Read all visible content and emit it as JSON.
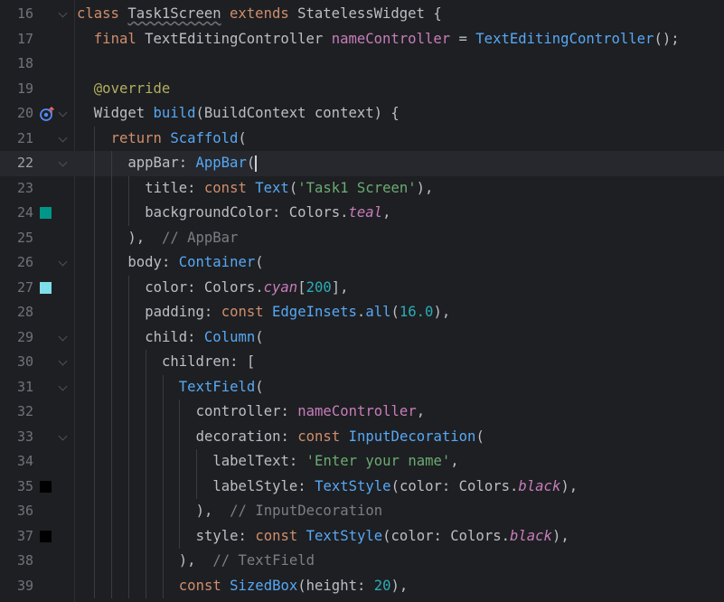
{
  "editor": {
    "current_line": "22",
    "lines": [
      {
        "n": "16",
        "ind": 0,
        "fold": true,
        "tokens": [
          {
            "t": "class ",
            "c": "kw"
          },
          {
            "t": "Task1Screen",
            "c": "cls wavy"
          },
          {
            "t": " extends ",
            "c": "kw"
          },
          {
            "t": "StatelessWidget {",
            "c": "cls"
          }
        ]
      },
      {
        "n": "17",
        "ind": 1,
        "tokens": [
          {
            "t": "final ",
            "c": "kw"
          },
          {
            "t": "TextEditingController ",
            "c": "cls"
          },
          {
            "t": "nameController",
            "c": "fld"
          },
          {
            "t": " = ",
            "c": "cls"
          },
          {
            "t": "TextEditingController",
            "c": "typ"
          },
          {
            "t": "();",
            "c": "cls"
          }
        ]
      },
      {
        "n": "18",
        "ind": 0,
        "tokens": []
      },
      {
        "n": "19",
        "ind": 1,
        "tokens": [
          {
            "t": "@override",
            "c": "ann"
          }
        ]
      },
      {
        "n": "20",
        "ind": 1,
        "fold": true,
        "icon": "override-icon",
        "tokens": [
          {
            "t": "Widget ",
            "c": "cls"
          },
          {
            "t": "build",
            "c": "typ"
          },
          {
            "t": "(BuildContext context) {",
            "c": "cls"
          }
        ]
      },
      {
        "n": "21",
        "ind": 2,
        "fold": true,
        "tokens": [
          {
            "t": "return ",
            "c": "kw"
          },
          {
            "t": "Scaffold",
            "c": "typ"
          },
          {
            "t": "(",
            "c": "cls"
          }
        ]
      },
      {
        "n": "22",
        "ind": 3,
        "fold": true,
        "caret": true,
        "tokens": [
          {
            "t": "appBar: ",
            "c": "cls"
          },
          {
            "t": "AppBar",
            "c": "typ"
          },
          {
            "t": "(",
            "c": "cls"
          }
        ]
      },
      {
        "n": "23",
        "ind": 4,
        "tokens": [
          {
            "t": "title: ",
            "c": "cls"
          },
          {
            "t": "const ",
            "c": "kw"
          },
          {
            "t": "Text",
            "c": "typ"
          },
          {
            "t": "(",
            "c": "cls"
          },
          {
            "t": "'Task1 Screen'",
            "c": "str"
          },
          {
            "t": "),",
            "c": "cls"
          }
        ]
      },
      {
        "n": "24",
        "ind": 4,
        "swatch": "#009688",
        "tokens": [
          {
            "t": "backgroundColor: Colors.",
            "c": "cls"
          },
          {
            "t": "teal",
            "c": "it"
          },
          {
            "t": ",",
            "c": "cls"
          }
        ]
      },
      {
        "n": "25",
        "ind": 3,
        "tokens": [
          {
            "t": "),  ",
            "c": "cls"
          },
          {
            "t": "// AppBar",
            "c": "cmt"
          }
        ]
      },
      {
        "n": "26",
        "ind": 3,
        "fold": true,
        "tokens": [
          {
            "t": "body: ",
            "c": "cls"
          },
          {
            "t": "Container",
            "c": "typ"
          },
          {
            "t": "(",
            "c": "cls"
          }
        ]
      },
      {
        "n": "27",
        "ind": 4,
        "swatch": "#80deea",
        "tokens": [
          {
            "t": "color: Colors.",
            "c": "cls"
          },
          {
            "t": "cyan",
            "c": "it"
          },
          {
            "t": "[",
            "c": "cls"
          },
          {
            "t": "200",
            "c": "num"
          },
          {
            "t": "],",
            "c": "cls"
          }
        ]
      },
      {
        "n": "28",
        "ind": 4,
        "tokens": [
          {
            "t": "padding: ",
            "c": "cls"
          },
          {
            "t": "const ",
            "c": "kw"
          },
          {
            "t": "EdgeInsets",
            "c": "typ"
          },
          {
            "t": ".",
            "c": "cls"
          },
          {
            "t": "all",
            "c": "typ"
          },
          {
            "t": "(",
            "c": "cls"
          },
          {
            "t": "16.0",
            "c": "num"
          },
          {
            "t": "),",
            "c": "cls"
          }
        ]
      },
      {
        "n": "29",
        "ind": 4,
        "fold": true,
        "tokens": [
          {
            "t": "child: ",
            "c": "cls"
          },
          {
            "t": "Column",
            "c": "typ"
          },
          {
            "t": "(",
            "c": "cls"
          }
        ]
      },
      {
        "n": "30",
        "ind": 5,
        "fold": true,
        "tokens": [
          {
            "t": "children: [",
            "c": "cls"
          }
        ]
      },
      {
        "n": "31",
        "ind": 6,
        "fold": true,
        "tokens": [
          {
            "t": "TextField",
            "c": "typ"
          },
          {
            "t": "(",
            "c": "cls"
          }
        ]
      },
      {
        "n": "32",
        "ind": 7,
        "tokens": [
          {
            "t": "controller: ",
            "c": "cls"
          },
          {
            "t": "nameController",
            "c": "fld"
          },
          {
            "t": ",",
            "c": "cls"
          }
        ]
      },
      {
        "n": "33",
        "ind": 7,
        "fold": true,
        "tokens": [
          {
            "t": "decoration: ",
            "c": "cls"
          },
          {
            "t": "const ",
            "c": "kw"
          },
          {
            "t": "InputDecoration",
            "c": "typ"
          },
          {
            "t": "(",
            "c": "cls"
          }
        ]
      },
      {
        "n": "34",
        "ind": 8,
        "tokens": [
          {
            "t": "labelText: ",
            "c": "cls"
          },
          {
            "t": "'Enter your name'",
            "c": "str"
          },
          {
            "t": ",",
            "c": "cls"
          }
        ]
      },
      {
        "n": "35",
        "ind": 8,
        "swatch": "#000000",
        "tokens": [
          {
            "t": "labelStyle: ",
            "c": "cls"
          },
          {
            "t": "TextStyle",
            "c": "typ"
          },
          {
            "t": "(color: Colors.",
            "c": "cls"
          },
          {
            "t": "black",
            "c": "it"
          },
          {
            "t": "),",
            "c": "cls"
          }
        ]
      },
      {
        "n": "36",
        "ind": 7,
        "tokens": [
          {
            "t": "),  ",
            "c": "cls"
          },
          {
            "t": "// InputDecoration",
            "c": "cmt"
          }
        ]
      },
      {
        "n": "37",
        "ind": 7,
        "swatch": "#000000",
        "tokens": [
          {
            "t": "style: ",
            "c": "cls"
          },
          {
            "t": "const ",
            "c": "kw"
          },
          {
            "t": "TextStyle",
            "c": "typ"
          },
          {
            "t": "(color: Colors.",
            "c": "cls"
          },
          {
            "t": "black",
            "c": "it"
          },
          {
            "t": "),",
            "c": "cls"
          }
        ]
      },
      {
        "n": "38",
        "ind": 6,
        "tokens": [
          {
            "t": "),  ",
            "c": "cls"
          },
          {
            "t": "// TextField",
            "c": "cmt"
          }
        ]
      },
      {
        "n": "39",
        "ind": 6,
        "tokens": [
          {
            "t": "const ",
            "c": "kw"
          },
          {
            "t": "SizedBox",
            "c": "typ"
          },
          {
            "t": "(height: ",
            "c": "cls"
          },
          {
            "t": "20",
            "c": "num"
          },
          {
            "t": "),",
            "c": "cls"
          }
        ]
      }
    ]
  }
}
